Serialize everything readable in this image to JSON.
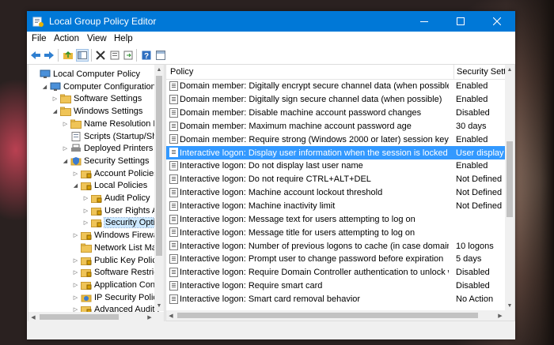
{
  "window": {
    "title": "Local Group Policy Editor",
    "accent": "#0078d7"
  },
  "menu": [
    "File",
    "Action",
    "View",
    "Help"
  ],
  "toolbar_icons": [
    "back-icon",
    "forward-icon",
    "up-folder-icon",
    "show-hide-tree-icon",
    "delete-icon",
    "properties-icon",
    "export-list-icon",
    "help-icon",
    "extended-view-icon"
  ],
  "tree": [
    {
      "label": "Local Computer Policy",
      "icon": "computer-icon",
      "expander": "none"
    },
    {
      "label": "Computer Configuration",
      "icon": "computer-icon",
      "expander": "expanded"
    },
    {
      "label": "Software Settings",
      "icon": "folder-icon",
      "expander": "collapsed"
    },
    {
      "label": "Windows Settings",
      "icon": "folder-icon",
      "expander": "expanded"
    },
    {
      "label": "Name Resolution Poli",
      "icon": "folder-icon",
      "expander": "collapsed"
    },
    {
      "label": "Scripts (Startup/Shutd",
      "icon": "script-icon",
      "expander": "none"
    },
    {
      "label": "Deployed Printers",
      "icon": "printer-icon",
      "expander": "collapsed"
    },
    {
      "label": "Security Settings",
      "icon": "security-icon",
      "expander": "expanded"
    },
    {
      "label": "Account Policies",
      "icon": "folder-lock-icon",
      "expander": "collapsed"
    },
    {
      "label": "Local Policies",
      "icon": "folder-lock-icon",
      "expander": "expanded"
    },
    {
      "label": "Audit Policy",
      "icon": "folder-lock-icon",
      "expander": "collapsed"
    },
    {
      "label": "User Rights Ass",
      "icon": "folder-lock-icon",
      "expander": "collapsed"
    },
    {
      "label": "Security Option",
      "icon": "folder-lock-icon",
      "expander": "collapsed",
      "selected": true
    },
    {
      "label": "Windows Firewall",
      "icon": "folder-lock-icon",
      "expander": "collapsed"
    },
    {
      "label": "Network List Mana",
      "icon": "folder-icon",
      "expander": "none"
    },
    {
      "label": "Public Key Policies",
      "icon": "folder-lock-icon",
      "expander": "collapsed"
    },
    {
      "label": "Software Restricti",
      "icon": "folder-lock-icon",
      "expander": "collapsed"
    },
    {
      "label": "Application Contro",
      "icon": "folder-lock-icon",
      "expander": "collapsed"
    },
    {
      "label": "IP Security Policies",
      "icon": "ip-security-icon",
      "expander": "collapsed"
    },
    {
      "label": "Advanced Audit P",
      "icon": "folder-lock-icon",
      "expander": "collapsed"
    }
  ],
  "list": {
    "columns": [
      "Policy",
      "Security Setti"
    ],
    "rows": [
      {
        "policy": "Domain member: Digitally encrypt secure channel data (when possible)",
        "setting": "Enabled"
      },
      {
        "policy": "Domain member: Digitally sign secure channel data (when possible)",
        "setting": "Enabled"
      },
      {
        "policy": "Domain member: Disable machine account password changes",
        "setting": "Disabled"
      },
      {
        "policy": "Domain member: Maximum machine account password age",
        "setting": "30 days"
      },
      {
        "policy": "Domain member: Require strong (Windows 2000 or later) session key",
        "setting": "Enabled"
      },
      {
        "policy": "Interactive logon: Display user information when the session is locked",
        "setting": "User display n",
        "selected": true
      },
      {
        "policy": "Interactive logon: Do not display last user name",
        "setting": "Enabled"
      },
      {
        "policy": "Interactive logon: Do not require CTRL+ALT+DEL",
        "setting": "Not Defined"
      },
      {
        "policy": "Interactive logon: Machine account lockout threshold",
        "setting": "Not Defined"
      },
      {
        "policy": "Interactive logon: Machine inactivity limit",
        "setting": "Not Defined"
      },
      {
        "policy": "Interactive logon: Message text for users attempting to log on",
        "setting": ""
      },
      {
        "policy": "Interactive logon: Message title for users attempting to log on",
        "setting": ""
      },
      {
        "policy": "Interactive logon: Number of previous logons to cache (in case domain c...",
        "setting": "10 logons"
      },
      {
        "policy": "Interactive logon: Prompt user to change password before expiration",
        "setting": "5 days"
      },
      {
        "policy": "Interactive logon: Require Domain Controller authentication to unlock w...",
        "setting": "Disabled"
      },
      {
        "policy": "Interactive logon: Require smart card",
        "setting": "Disabled"
      },
      {
        "policy": "Interactive logon: Smart card removal behavior",
        "setting": "No Action"
      }
    ],
    "selection_color": "#3399ff"
  }
}
